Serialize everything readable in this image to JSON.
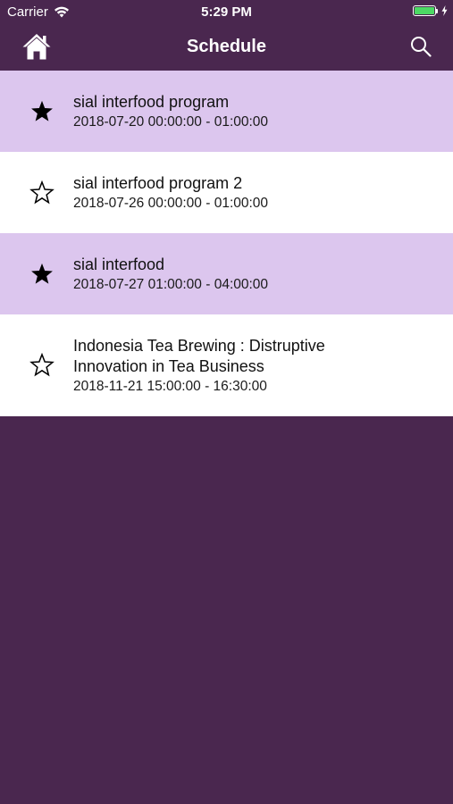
{
  "status_bar": {
    "carrier": "Carrier",
    "time": "5:29 PM",
    "battery_level": 1.0,
    "battery_color": "#4cd964"
  },
  "nav": {
    "title": "Schedule",
    "left_icon": "home-icon",
    "right_icon": "search-icon",
    "background": "#4a274f"
  },
  "schedule": {
    "favorite_row_color": "#dcc6ee",
    "items": [
      {
        "title": "sial interfood program",
        "datetime": "2018-07-20 00:00:00 - 01:00:00",
        "favorite": true
      },
      {
        "title": "sial interfood program 2",
        "datetime": "2018-07-26 00:00:00 - 01:00:00",
        "favorite": false
      },
      {
        "title": "sial interfood",
        "datetime": "2018-07-27 01:00:00 - 04:00:00",
        "favorite": true
      },
      {
        "title": "Indonesia Tea Brewing : Distruptive Innovation in Tea Business",
        "datetime": "2018-11-21 15:00:00 - 16:30:00",
        "favorite": false
      }
    ]
  }
}
